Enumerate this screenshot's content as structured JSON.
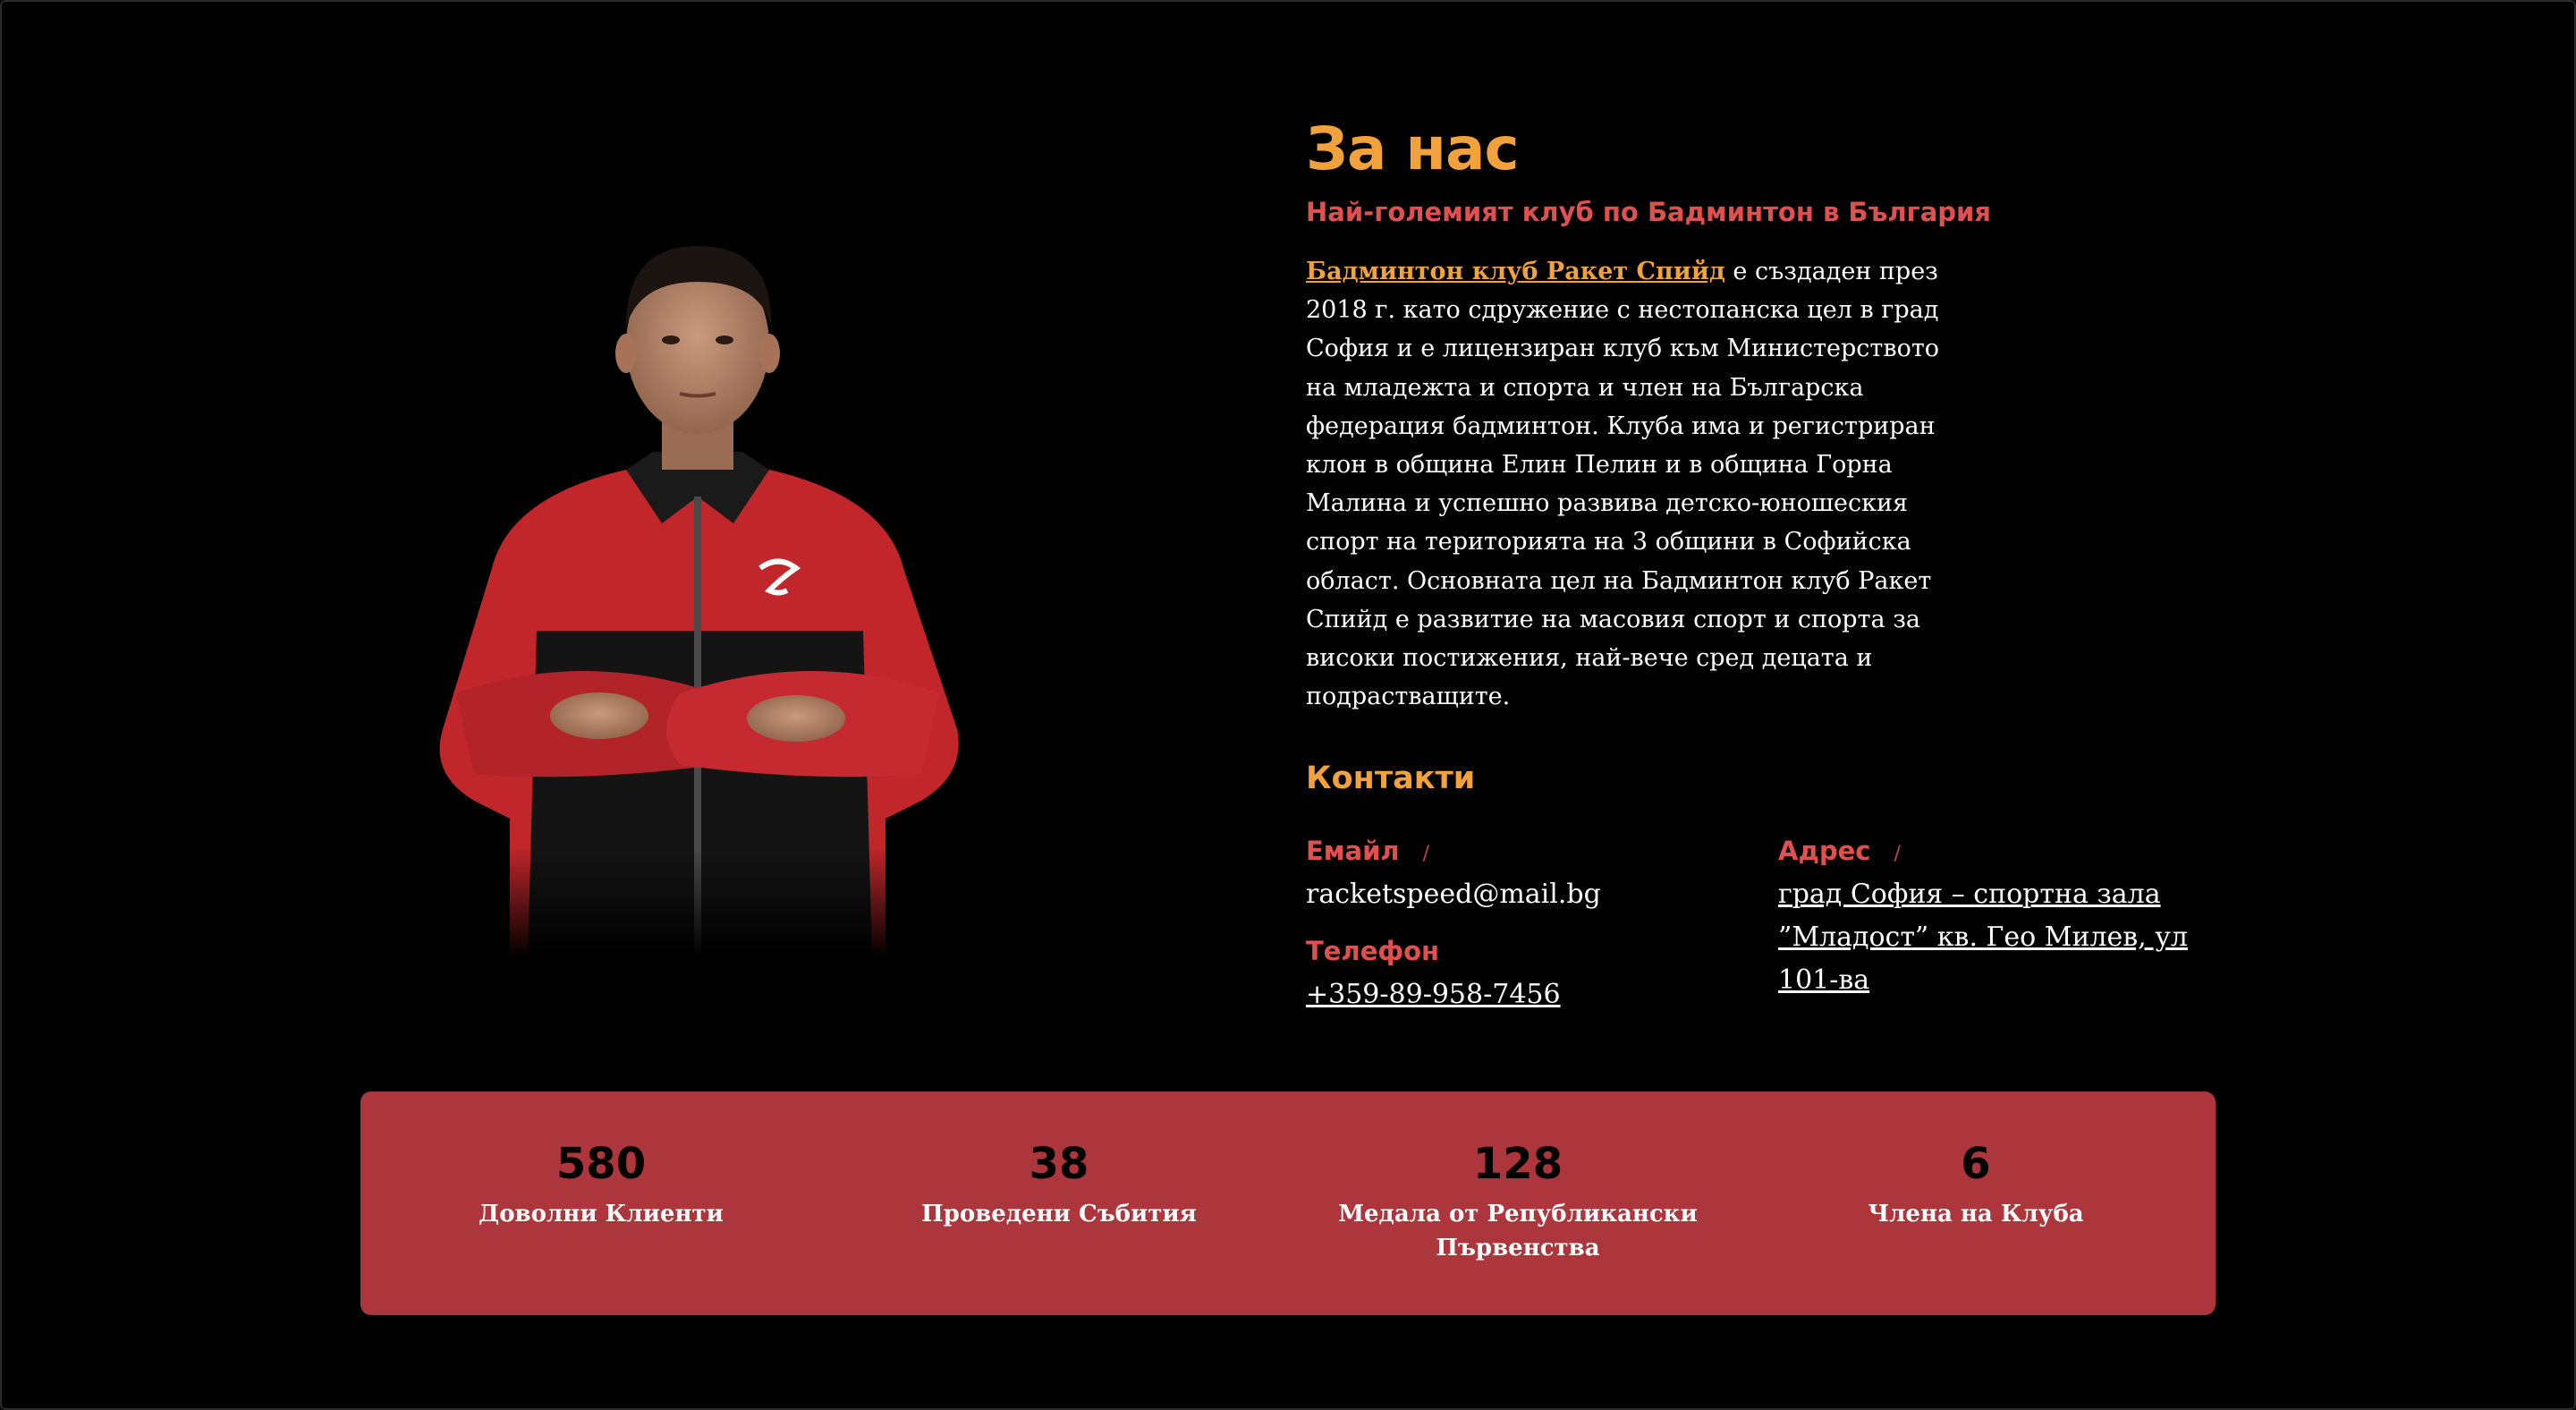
{
  "about": {
    "title": "За нас",
    "subtitle": "Най-големият клуб по Бадминтон в България",
    "club_link": "Бадминтон клуб Ракет Спийд",
    "text": " е създаден през 2018 г. като сдружение с нестопанска цел в град София и е лицензиран клуб към Министерството на младежта и спорта и член на Българска федерация бадминтон. Клуба има и регистриран клон в община Елин Пелин и в община Горна Малина и успешно развива детско-юношеския спорт на територията на 3 общини в Софийска област. Основната цел на Бадминтон клуб Ракет Спийд е развитие на масовия спорт и спорта за високи постижения, най-вече сред децата и подрастващите."
  },
  "contacts": {
    "title": "Контакти",
    "email_label": "Емайл",
    "email_value": "racketspeed@mail.bg",
    "phone_label": "Телефон",
    "phone_value": "+359-89-958-7456",
    "address_label": "Адрес",
    "address_value": "град София – спортна зала ”Младост” кв. Гео Милев, ул 101-ва",
    "separator": "/"
  },
  "stats": [
    {
      "value": "580",
      "label": "Доволни Клиенти"
    },
    {
      "value": "38",
      "label": "Проведени Събития"
    },
    {
      "value": "128",
      "label": "Медала от Републикански Първенства"
    },
    {
      "value": "6",
      "label": "Члена на Клуба"
    }
  ],
  "colors": {
    "background": "#000000",
    "accent_orange": "#f2a23c",
    "accent_red": "#e0504f",
    "stats_background": "#ad363d"
  }
}
